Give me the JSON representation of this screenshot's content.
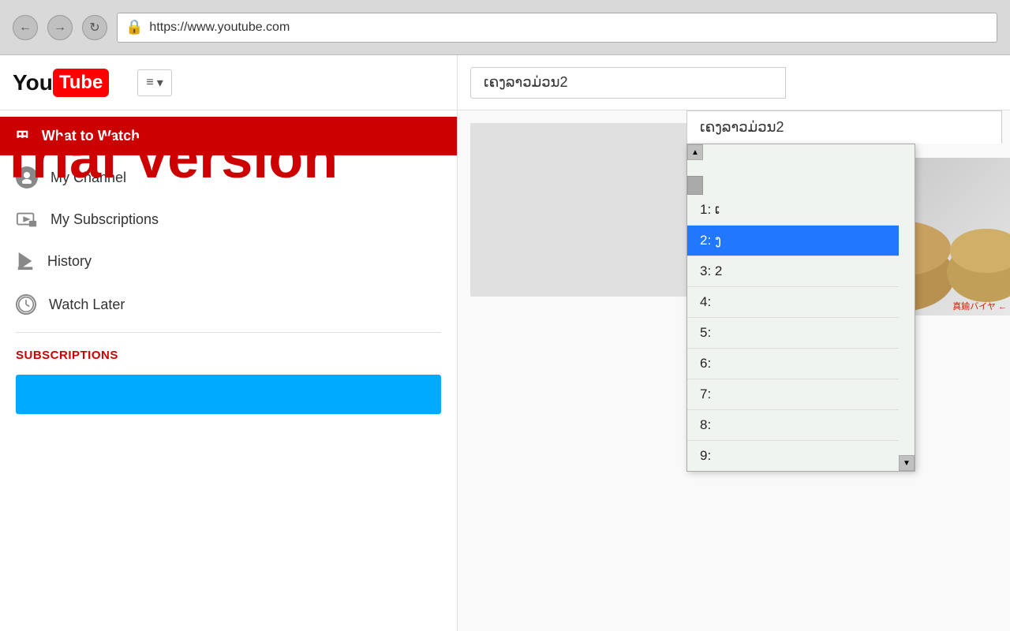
{
  "browser": {
    "back_btn": "←",
    "forward_btn": "→",
    "refresh_btn": "↻",
    "url": "https://www.youtube.com",
    "lock_icon": "🔒"
  },
  "youtube": {
    "logo_you": "You",
    "logo_tube": "Tube",
    "hamburger": "≡",
    "hamburger_arrow": "▾"
  },
  "trial": {
    "text": "Trial Version"
  },
  "nav": {
    "what_to_watch": "What to Watch",
    "my_channel": "My Channel",
    "my_subscriptions": "My Subscriptions",
    "history": "History",
    "watch_later": "Watch Later",
    "subscriptions_label": "SUBSCRIPTIONS"
  },
  "search": {
    "value": "ເຄງລາວມ່ວນ2"
  },
  "dropdown": {
    "items": [
      {
        "id": "1",
        "label": "1: ເ"
      },
      {
        "id": "2",
        "label": "2: ງ",
        "selected": true
      },
      {
        "id": "3",
        "label": "3: 2"
      },
      {
        "id": "4",
        "label": "4:"
      },
      {
        "id": "5",
        "label": "5:"
      },
      {
        "id": "6",
        "label": "6:"
      },
      {
        "id": "7",
        "label": "7:"
      },
      {
        "id": "8",
        "label": "8:"
      },
      {
        "id": "9",
        "label": "9:"
      }
    ]
  },
  "thumbnail": {
    "label": "真鍮バイヤ ←"
  }
}
